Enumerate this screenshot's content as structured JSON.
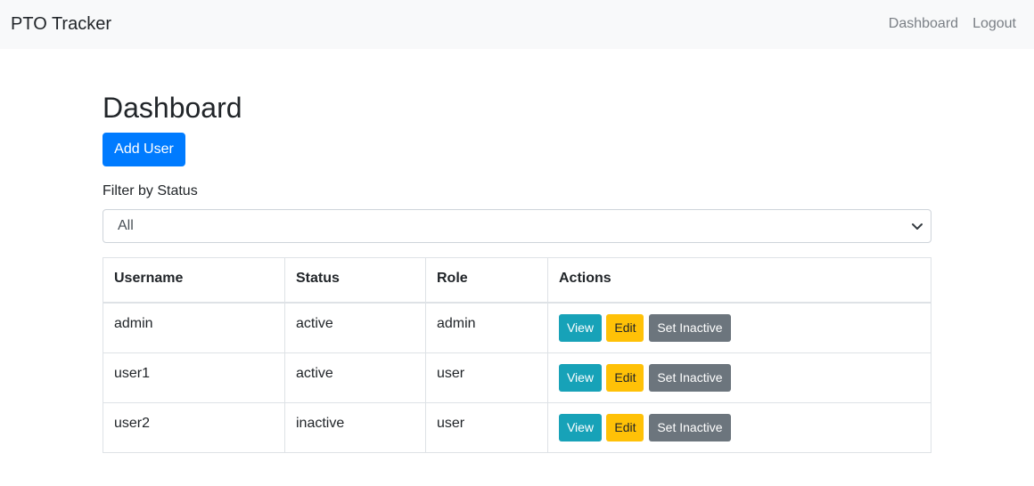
{
  "navbar": {
    "brand": "PTO Tracker",
    "links": [
      "Dashboard",
      "Logout"
    ]
  },
  "page": {
    "title": "Dashboard",
    "add_user_label": "Add User"
  },
  "filter": {
    "label": "Filter by Status",
    "selected": "All"
  },
  "table": {
    "headers": [
      "Username",
      "Status",
      "Role",
      "Actions"
    ],
    "rows": [
      {
        "username": "admin",
        "status": "active",
        "role": "admin"
      },
      {
        "username": "user1",
        "status": "active",
        "role": "user"
      },
      {
        "username": "user2",
        "status": "inactive",
        "role": "user"
      }
    ],
    "actions": {
      "view": "View",
      "edit": "Edit",
      "inactive": "Set Inactive"
    }
  },
  "colors": {
    "primary": "#007bff",
    "info": "#17a2b8",
    "warning": "#ffc107",
    "secondary": "#6c757d"
  },
  "icons": {
    "select_arrow": "chevron-down-icon"
  }
}
